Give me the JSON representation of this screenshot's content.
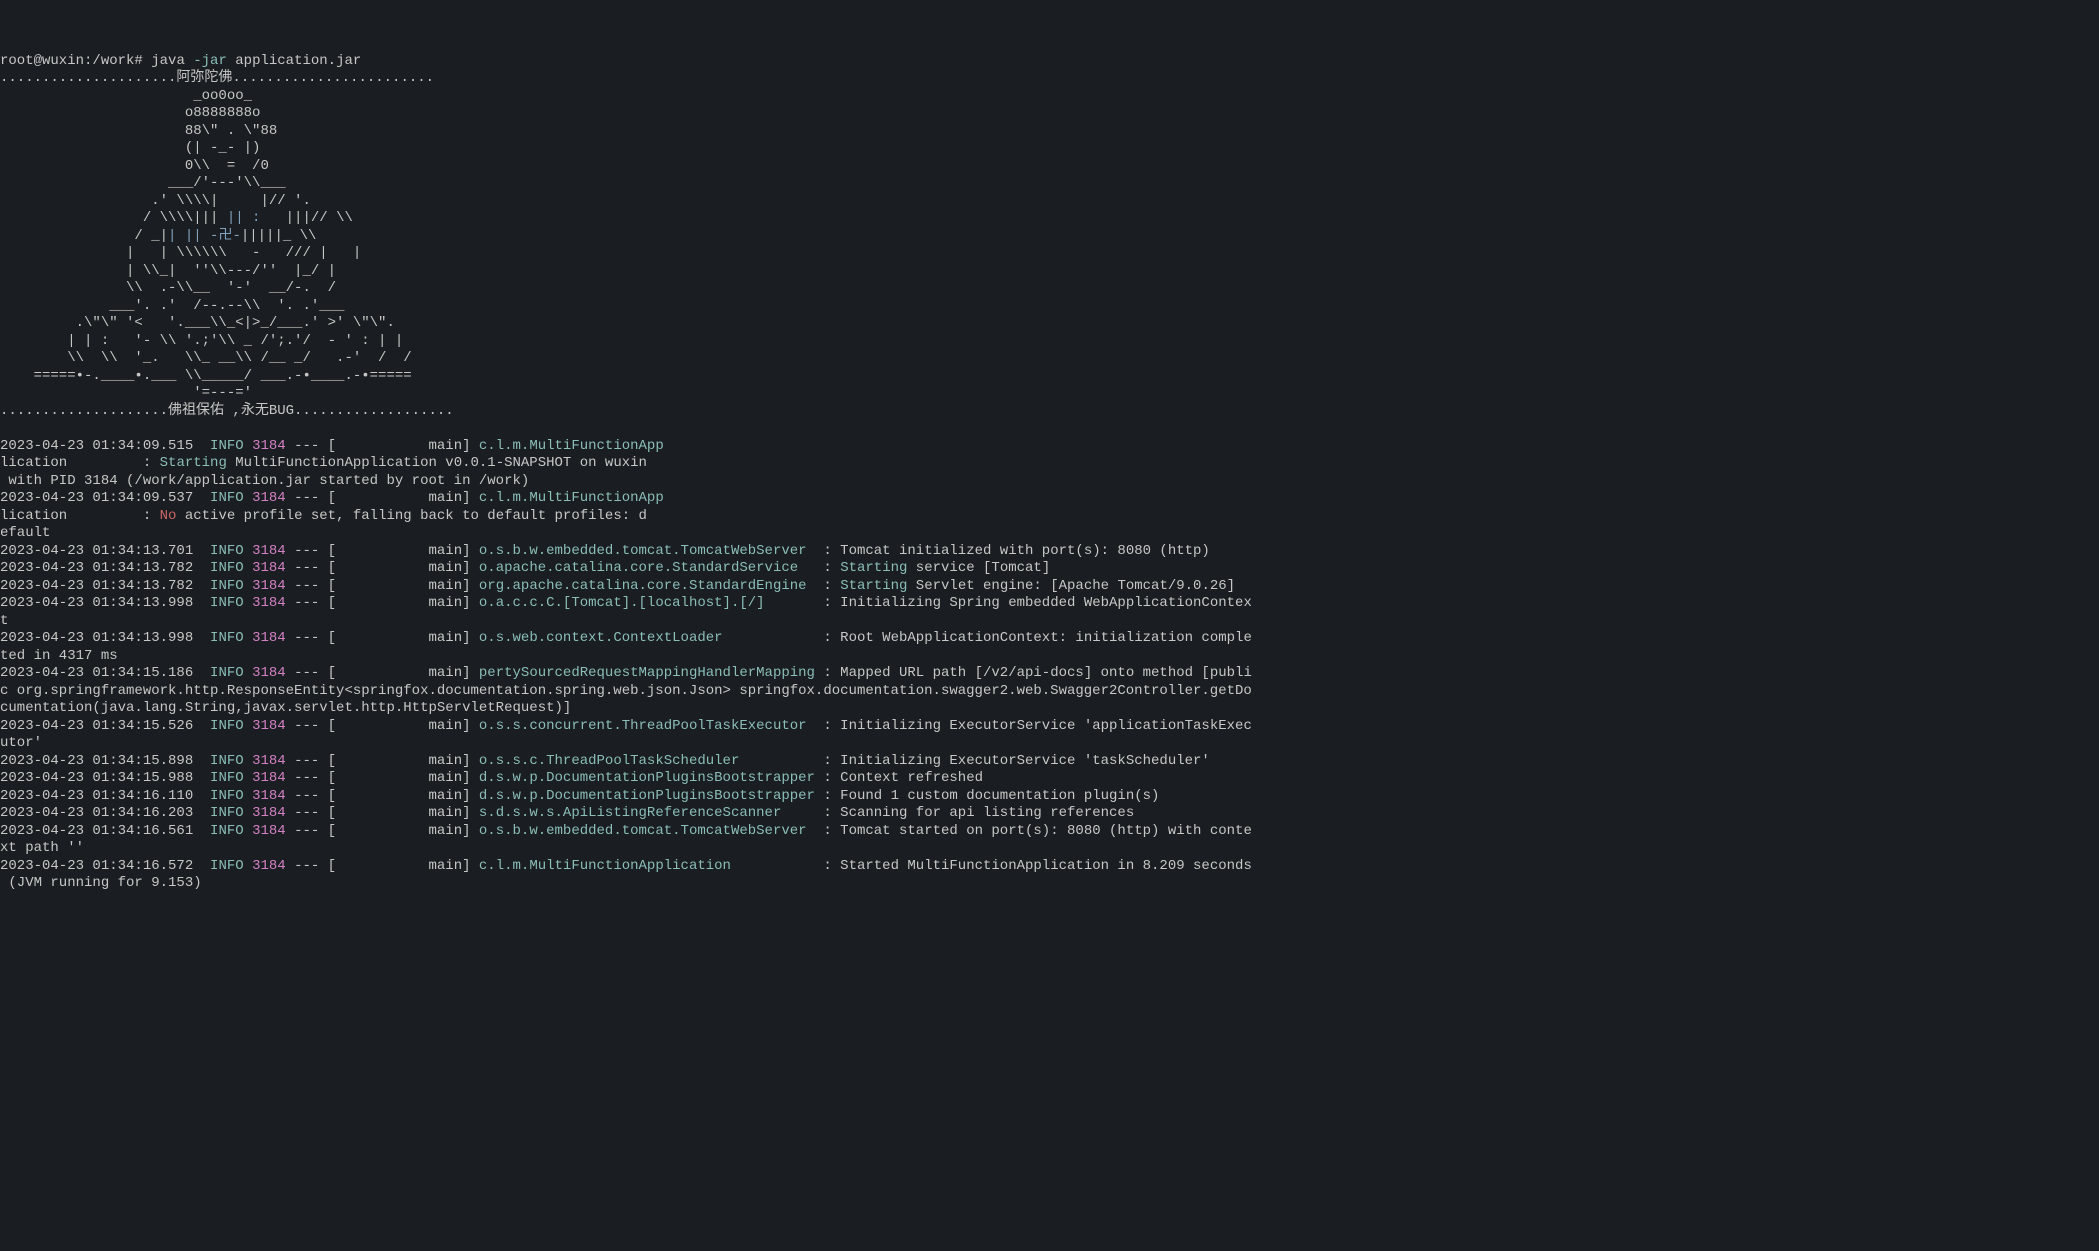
{
  "prompt": {
    "text": "root@wuxin:/work# ",
    "cmd": "java ",
    "opt": "-jar",
    "arg": " application.jar"
  },
  "ascii": {
    "l1": ".....................阿弥陀佛........................",
    "l2": "                       _oo0oo_",
    "l3": "                      o8888888o",
    "l4": "                      88\\\" . \\\"88",
    "l5": "                      (| -_- |)",
    "l6": "                      0\\\\  =  /0",
    "l7": "                    ___/'---'\\\\___",
    "l8": "                  .' \\\\\\\\|     |// '.",
    "l9a": "                 / \\\\\\\\|||",
    "l9b": " || :",
    "l9c": "   |||// \\\\",
    "l10a": "                / _|",
    "l10b": "| || -卍-",
    "l10c": "|||||_ \\\\",
    "l11": "               |   | \\\\\\\\\\\\   -   /// |   |",
    "l12": "               | \\\\_|  ''\\\\---/''  |_/ |",
    "l13": "               \\\\  .-\\\\__  '-'  __/-.  /",
    "l14": "             ___'. .'  /--.--\\\\  '. .'___",
    "l15": "         .\\\"\\\" '<   '.___\\\\_<|>_/___.' >' \\\"\\\".",
    "l16": "        | | :   '- \\\\ '.;'\\\\ _ /';.'/  - ' : | |",
    "l17": "        \\\\  \\\\  '_.   \\\\_ __\\\\ /__ _/   .-'  /  /",
    "l18": "    =====•-.____•.___ \\\\_____/ ___.-•____.-•=====",
    "l19": "                       '=---='",
    "l20": "....................佛祖保佑 ,永无BUG..................."
  },
  "logs": [
    {
      "ts": "2023-04-23 01:34:09.515",
      "lvl": "INFO",
      "pid": "3184",
      "sep": " --- [           main] ",
      "logger": "c.l.m.MultiFunctionApp",
      "msg": ""
    },
    {
      "cont": "lication         : ",
      "kw": "Starting",
      "rest": " MultiFunctionApplication v0.0.1-SNAPSHOT on wuxin"
    },
    {
      "plain": " with PID 3184 (/work/application.jar started by root in /work)"
    },
    {
      "ts": "2023-04-23 01:34:09.537",
      "lvl": "INFO",
      "pid": "3184",
      "sep": " --- [           main] ",
      "logger": "c.l.m.MultiFunctionApp",
      "msg": ""
    },
    {
      "cont": "lication         : ",
      "kw_red": "No",
      "rest": " active profile set, falling back to default profiles: d"
    },
    {
      "plain": "efault"
    },
    {
      "ts": "2023-04-23 01:34:13.701",
      "lvl": "INFO",
      "pid": "3184",
      "sep": " --- [           main] ",
      "logger": "o.s.b.w.embedded.tomcat.TomcatWebServer  ",
      "msg": ": Tomcat initialized with port(s): 8080 (http)"
    },
    {
      "ts": "2023-04-23 01:34:13.782",
      "lvl": "INFO",
      "pid": "3184",
      "sep": " --- [           main] ",
      "logger": "o.apache.catalina.core.StandardService   ",
      "msg": ": ",
      "kw": "Starting",
      "rest": " service [Tomcat]"
    },
    {
      "ts": "2023-04-23 01:34:13.782",
      "lvl": "INFO",
      "pid": "3184",
      "sep": " --- [           main] ",
      "logger": "org.apache.catalina.core.StandardEngine  ",
      "msg": ": ",
      "kw": "Starting",
      "rest": " Servlet engine: [Apache Tomcat/9.0.26]"
    },
    {
      "ts": "2023-04-23 01:34:13.998",
      "lvl": "INFO",
      "pid": "3184",
      "sep": " --- [           main] ",
      "logger": "o.a.c.c.C.[Tomcat].[localhost].[/]       ",
      "msg": ": Initializing Spring embedded WebApplicationContex"
    },
    {
      "plain": "t"
    },
    {
      "ts": "2023-04-23 01:34:13.998",
      "lvl": "INFO",
      "pid": "3184",
      "sep": " --- [           main] ",
      "logger": "o.s.web.context.ContextLoader            ",
      "msg": ": Root WebApplicationContext: initialization comple"
    },
    {
      "plain": "ted in 4317 ms"
    },
    {
      "ts": "2023-04-23 01:34:15.186",
      "lvl": "INFO",
      "pid": "3184",
      "sep": " --- [           main] ",
      "logger": "pertySourcedRequestMappingHandlerMapping ",
      "msg": ": Mapped URL path [/v2/api-docs] onto method [publi"
    },
    {
      "plain": "c org.springframework.http.ResponseEntity<springfox.documentation.spring.web.json.Json> springfox.documentation.swagger2.web.Swagger2Controller.getDo"
    },
    {
      "plain": "cumentation(java.lang.String,javax.servlet.http.HttpServletRequest)]"
    },
    {
      "ts": "2023-04-23 01:34:15.526",
      "lvl": "INFO",
      "pid": "3184",
      "sep": " --- [           main] ",
      "logger": "o.s.s.concurrent.ThreadPoolTaskExecutor  ",
      "msg": ": Initializing ExecutorService 'applicationTaskExec"
    },
    {
      "plain": "utor'"
    },
    {
      "ts": "2023-04-23 01:34:15.898",
      "lvl": "INFO",
      "pid": "3184",
      "sep": " --- [           main] ",
      "logger": "o.s.s.c.ThreadPoolTaskScheduler          ",
      "msg": ": Initializing ExecutorService 'taskScheduler'"
    },
    {
      "ts": "2023-04-23 01:34:15.988",
      "lvl": "INFO",
      "pid": "3184",
      "sep": " --- [           main] ",
      "logger": "d.s.w.p.DocumentationPluginsBootstrapper ",
      "msg": ": Context refreshed"
    },
    {
      "ts": "2023-04-23 01:34:16.110",
      "lvl": "INFO",
      "pid": "3184",
      "sep": " --- [           main] ",
      "logger": "d.s.w.p.DocumentationPluginsBootstrapper ",
      "msg": ": Found 1 custom documentation plugin(s)"
    },
    {
      "ts": "2023-04-23 01:34:16.203",
      "lvl": "INFO",
      "pid": "3184",
      "sep": " --- [           main] ",
      "logger": "s.d.s.w.s.ApiListingReferenceScanner     ",
      "msg": ": Scanning for api listing references"
    },
    {
      "ts": "2023-04-23 01:34:16.561",
      "lvl": "INFO",
      "pid": "3184",
      "sep": " --- [           main] ",
      "logger": "o.s.b.w.embedded.tomcat.TomcatWebServer  ",
      "msg": ": Tomcat started on port(s): 8080 (http) with conte"
    },
    {
      "plain": "xt path ''"
    },
    {
      "ts": "2023-04-23 01:34:16.572",
      "lvl": "INFO",
      "pid": "3184",
      "sep": " --- [           main] ",
      "logger": "c.l.m.MultiFunctionApplication           ",
      "msg": ": Started MultiFunctionApplication in 8.209 seconds"
    },
    {
      "plain": " (JVM running for 9.153)"
    }
  ]
}
